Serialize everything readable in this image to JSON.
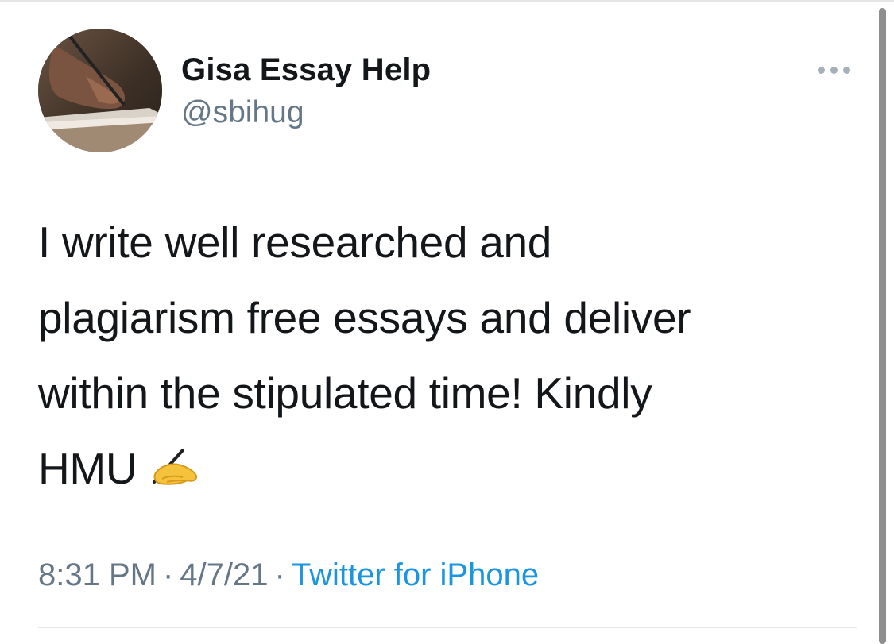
{
  "tweet": {
    "display_name": "Gisa Essay Help",
    "handle": "@sbihug",
    "text_lines": [
      "I write well researched and",
      "plagiarism free essays and deliver",
      "within the stipulated time! Kindly",
      "HMU"
    ],
    "emoji": "writing-hand-icon",
    "time": "8:31 PM",
    "separator": "·",
    "date": "4/7/21",
    "source": "Twitter for iPhone"
  },
  "icons": {
    "more": "more-options-icon",
    "avatar": "avatar"
  },
  "colors": {
    "text": "#14171a",
    "secondary": "#657786",
    "link": "#1b95e0",
    "divider": "#e6e6e6"
  }
}
